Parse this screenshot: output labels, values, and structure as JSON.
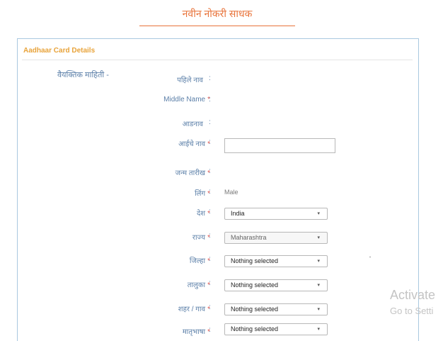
{
  "page": {
    "title": "नवीन नोकरी साधक"
  },
  "panel": {
    "heading": "Aadhaar Card Details",
    "section_label": "वैयक्तिक माहिती -"
  },
  "form": {
    "first_name": {
      "label": "पहिले नाव",
      "required": false,
      "colon": ":"
    },
    "middle_name": {
      "label": "Middle Name",
      "required": true,
      "req_mark": "*",
      "colon": ":"
    },
    "last_name": {
      "label": "आडनाव",
      "required": false,
      "colon": ":"
    },
    "mother_name": {
      "label": "आईचे नाव",
      "required": true,
      "req_mark": "*",
      "colon": ":",
      "value": ""
    },
    "dob": {
      "label": "जन्म तारीख",
      "required": true,
      "req_mark": "*",
      "colon": ":"
    },
    "gender": {
      "label": "लिंग",
      "required": true,
      "req_mark": "*",
      "colon": ":",
      "value": "Male"
    },
    "country": {
      "label": "देश",
      "required": true,
      "req_mark": "*",
      "colon": ":",
      "value": "India"
    },
    "state": {
      "label": "राज्य",
      "required": true,
      "req_mark": "*",
      "colon": ":",
      "value": "Maharashtra"
    },
    "district": {
      "label": "जिल्हा",
      "required": true,
      "req_mark": "*",
      "colon": ":",
      "value": "Nothing selected"
    },
    "taluka": {
      "label": "तालुका",
      "required": true,
      "req_mark": "*",
      "colon": ":",
      "value": "Nothing selected"
    },
    "city_village": {
      "label": "शहर / गाव",
      "required": true,
      "req_mark": "*",
      "colon": ":",
      "value": "Nothing selected"
    },
    "mother_tongue": {
      "label": "मातृभाषा",
      "required": true,
      "req_mark": "*",
      "colon": ":",
      "value": "Nothing selected"
    }
  },
  "caret_glyph": "▾",
  "watermark": {
    "line1": "Activate",
    "line2": "Go to Setti"
  },
  "colors": {
    "accent_orange": "#e8733a",
    "heading_amber": "#e8a33a",
    "label_blue": "#5b7fa8",
    "required_red": "#d9534f",
    "panel_border": "#a9c8e0"
  }
}
